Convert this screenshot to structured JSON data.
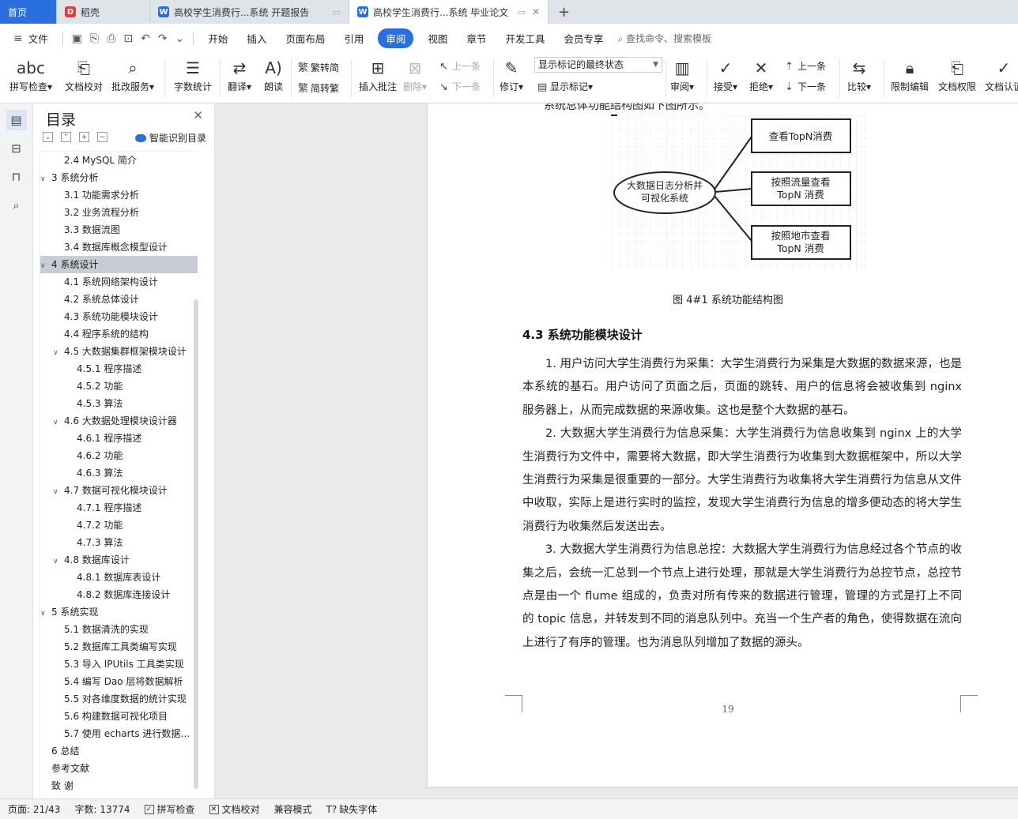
{
  "tabs": [
    {
      "label": "首页",
      "kind": "home"
    },
    {
      "label": "稻壳",
      "icon": "docer-icon"
    },
    {
      "label": "高校学生消费行...系统 开题报告",
      "icon": "word-icon"
    },
    {
      "label": "高校学生消费行...系统 毕业论文",
      "icon": "word-icon",
      "active": true
    }
  ],
  "menu": {
    "file": "文件",
    "items": [
      "开始",
      "插入",
      "页面布局",
      "引用",
      "审阅",
      "视图",
      "章节",
      "开发工具",
      "会员专享"
    ],
    "active": "审阅",
    "search": "查找命令、搜索模板"
  },
  "ribbon": {
    "spell": "拼写检查",
    "proof": "文档校对",
    "annotate_service": "批改服务",
    "word_count": "字数统计",
    "translate": "翻译",
    "read": "朗读",
    "to_traditional": "繁转简",
    "to_simplified": "简转繁",
    "insert_comment": "插入批注",
    "delete": "删除",
    "prev": "上一条",
    "next": "下一条",
    "revise": "修订",
    "markup_state": "显示标记的最终状态",
    "show_markup": "显示标记",
    "review": "审阅",
    "accept": "接受",
    "reject": "拒绝",
    "prev2": "上一条",
    "next2": "下一条",
    "compare": "比较",
    "restrict_edit": "限制编辑",
    "doc_permission": "文档权限",
    "doc_cert": "文档认证"
  },
  "toc": {
    "title": "目录",
    "smart": "智能识别目录",
    "items": [
      {
        "text": "2.4 MySQL 简介",
        "level": 2,
        "tw": ""
      },
      {
        "text": "3  系统分析",
        "level": 1,
        "tw": "v"
      },
      {
        "text": "3.1  功能需求分析",
        "level": 2,
        "tw": ""
      },
      {
        "text": "3.2  业务流程分析",
        "level": 2,
        "tw": ""
      },
      {
        "text": "3.3  数据流图",
        "level": 2,
        "tw": ""
      },
      {
        "text": "3.4  数据库概念模型设计",
        "level": 2,
        "tw": ""
      },
      {
        "text": "4  系统设计",
        "level": 1,
        "tw": "v",
        "selected": true
      },
      {
        "text": "4.1  系统网络架构设计",
        "level": 2,
        "tw": ""
      },
      {
        "text": "4.2  系统总体设计",
        "level": 2,
        "tw": ""
      },
      {
        "text": "4.3  系统功能模块设计",
        "level": 2,
        "tw": ""
      },
      {
        "text": "4.4  程序系统的结构",
        "level": 2,
        "tw": ""
      },
      {
        "text": "4.5  大数据集群框架模块设计",
        "level": 2,
        "tw": "v"
      },
      {
        "text": "4.5.1  程序描述",
        "level": 3,
        "tw": ""
      },
      {
        "text": "4.5.2  功能",
        "level": 3,
        "tw": ""
      },
      {
        "text": "4.5.3  算法",
        "level": 3,
        "tw": ""
      },
      {
        "text": "4.6  大数据处理模块设计器",
        "level": 2,
        "tw": "v"
      },
      {
        "text": "4.6.1  程序描述",
        "level": 3,
        "tw": ""
      },
      {
        "text": "4.6.2  功能",
        "level": 3,
        "tw": ""
      },
      {
        "text": "4.6.3  算法",
        "level": 3,
        "tw": ""
      },
      {
        "text": "4.7  数据可视化模块设计",
        "level": 2,
        "tw": "v"
      },
      {
        "text": "4.7.1  程序描述",
        "level": 3,
        "tw": ""
      },
      {
        "text": "4.7.2  功能",
        "level": 3,
        "tw": ""
      },
      {
        "text": "4.7.3  算法",
        "level": 3,
        "tw": ""
      },
      {
        "text": "4.8  数据库设计",
        "level": 2,
        "tw": "v"
      },
      {
        "text": "4.8.1  数据库表设计",
        "level": 3,
        "tw": ""
      },
      {
        "text": "4.8.2  数据库连接设计",
        "level": 3,
        "tw": ""
      },
      {
        "text": "5  系统实现",
        "level": 1,
        "tw": "v"
      },
      {
        "text": "5.1  数据清洗的实现",
        "level": 2,
        "tw": ""
      },
      {
        "text": "5.2  数据库工具类编写实现",
        "level": 2,
        "tw": ""
      },
      {
        "text": "5.3 导入 IPUtils 工具类实现",
        "level": 2,
        "tw": ""
      },
      {
        "text": "5.4 编写 Dao 层将数据解析",
        "level": 2,
        "tw": ""
      },
      {
        "text": "5.5  对各维度数据的统计实现",
        "level": 2,
        "tw": ""
      },
      {
        "text": "5.6  构建数据可视化项目",
        "level": 2,
        "tw": ""
      },
      {
        "text": "5.7  使用 echarts 进行数据展示",
        "level": 2,
        "tw": ""
      },
      {
        "text": "6  总结",
        "level": 1,
        "tw": ""
      },
      {
        "text": "参考文献",
        "level": 1,
        "tw": ""
      },
      {
        "text": "致    谢",
        "level": 1,
        "tw": ""
      }
    ]
  },
  "document": {
    "cut_line": "系统总体功能结构图如下图所示。",
    "diagram": {
      "center": [
        "大数据日志分析并",
        "可视化系统"
      ],
      "boxes": [
        [
          "查看TopN消费"
        ],
        [
          "按照流量查看",
          "TopN 消费"
        ],
        [
          "按照地市查看",
          "TopN 消费"
        ]
      ]
    },
    "caption": "图 4#1  系统功能结构图",
    "heading": "4.3  系统功能模块设计",
    "paragraphs": [
      "1. 用户访问大学生消费行为采集：大学生消费行为采集是大数据的数据来源，也是本系统的基石。用户访问了页面之后，页面的跳转、用户的信息将会被收集到 nginx 服务器上，从而完成数据的来源收集。这也是整个大数据的基石。",
      "2. 大数据大学生消费行为信息采集：大学生消费行为信息收集到 nginx 上的大学生消费行为文件中，需要将大数据，即大学生消费行为收集到大数据框架中，所以大学生消费行为采集是很重要的一部分。大学生消费行为收集将大学生消费行为信息从文件中收取，实际上是进行实时的监控，发现大学生消费行为信息的增多便动态的将大学生消费行为收集然后发送出去。",
      "3. 大数据大学生消费行为信息总控：大数据大学生消费行为信息经过各个节点的收集之后，会统一汇总到一个节点上进行处理，那就是大学生消费行为总控节点，总控节点是由一个 flume 组成的，负责对所有传来的数据进行管理，管理的方式是打上不同的 topic 信息，并转发到不同的消息队列中。充当一个生产者的角色，使得数据在流向上进行了有序的管理。也为消息队列增加了数据的源头。"
    ],
    "page_number": "19"
  },
  "status": {
    "page": "页面: 21/43",
    "words": "字数: 13774",
    "spell": "拼写检查",
    "proof": "文档校对",
    "compat": "兼容模式",
    "missing_font": "缺失字体"
  }
}
